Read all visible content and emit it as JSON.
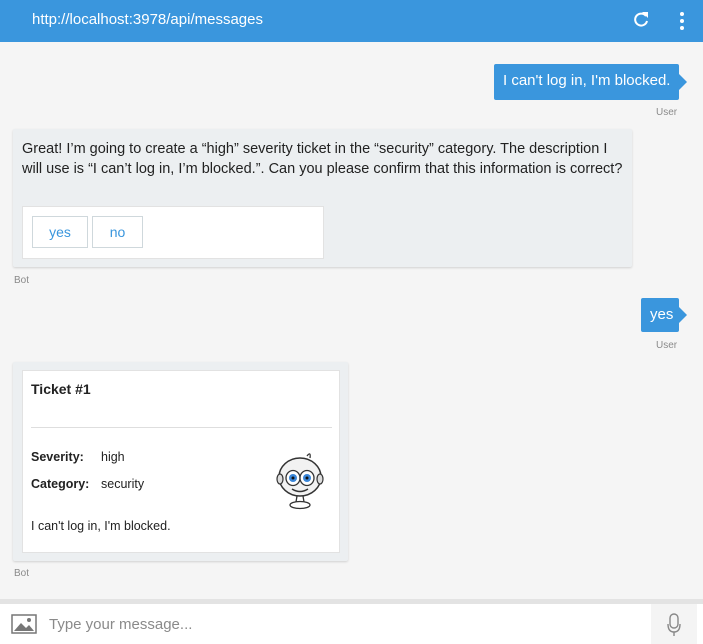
{
  "header": {
    "url": "http://localhost:3978/api/messages",
    "refresh_icon": "refresh-icon",
    "menu_icon": "more-vertical-icon"
  },
  "messages": [
    {
      "from": "User",
      "text": "I can't log in, I'm blocked."
    },
    {
      "from": "Bot",
      "text": "Great! I’m going to create a “high” severity ticket in the “security” category. The description I will use is “I can’t log in, I’m blocked.”. Can you please confirm that this information is correct?",
      "choices": [
        "yes",
        "no"
      ]
    },
    {
      "from": "User",
      "text": "yes"
    },
    {
      "from": "Bot",
      "card": {
        "title": "Ticket #1",
        "facts": [
          {
            "label": "Severity:",
            "value": "high"
          },
          {
            "label": "Category:",
            "value": "security"
          }
        ],
        "description": "I can't log in, I'm blocked.",
        "image_icon": "robot-icon"
      }
    }
  ],
  "composer": {
    "placeholder": "Type your message...",
    "upload_icon": "image-upload-icon",
    "mic_icon": "microphone-icon"
  },
  "colors": {
    "accent": "#3a96dd",
    "bot_bubble": "#eceff1",
    "background": "#f5f5f5"
  }
}
